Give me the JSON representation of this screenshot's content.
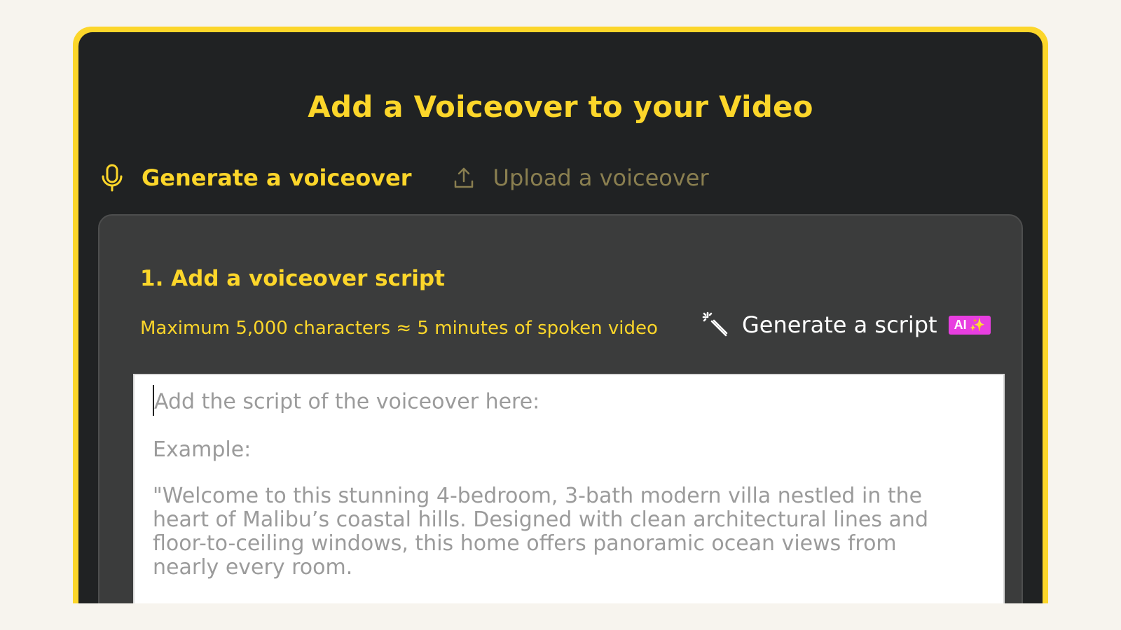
{
  "dialog": {
    "title": "Add a Voiceover to your Video"
  },
  "tabs": [
    {
      "label": "Generate a voiceover",
      "icon": "microphone-icon",
      "active": true
    },
    {
      "label": "Upload a voiceover",
      "icon": "upload-icon",
      "active": false
    }
  ],
  "step": {
    "title": "1. Add a voiceover script",
    "hint": "Maximum 5,000 characters ≈ 5 minutes of spoken video",
    "generate_script_label": "Generate a script",
    "generate_script_icon": "magic-wand-icon",
    "ai_badge": "AI",
    "ai_badge_sparkle": "✨"
  },
  "script_input": {
    "value": "",
    "placeholder_lines": [
      "Add the script of the voiceover here:",
      "Example:",
      "\"Welcome to this stunning 4-bedroom, 3-bath modern villa nestled in the",
      "heart of Malibu’s coastal hills. Designed with clean architectural lines and",
      "floor-to-ceiling windows, this home offers panoramic ocean views from",
      "nearly every room."
    ]
  },
  "colors": {
    "accent": "#fcd62a",
    "panel_bg": "#202223",
    "card_bg": "#3b3c3c",
    "badge": "#e83ee0",
    "page_bg": "#f7f4ee"
  }
}
